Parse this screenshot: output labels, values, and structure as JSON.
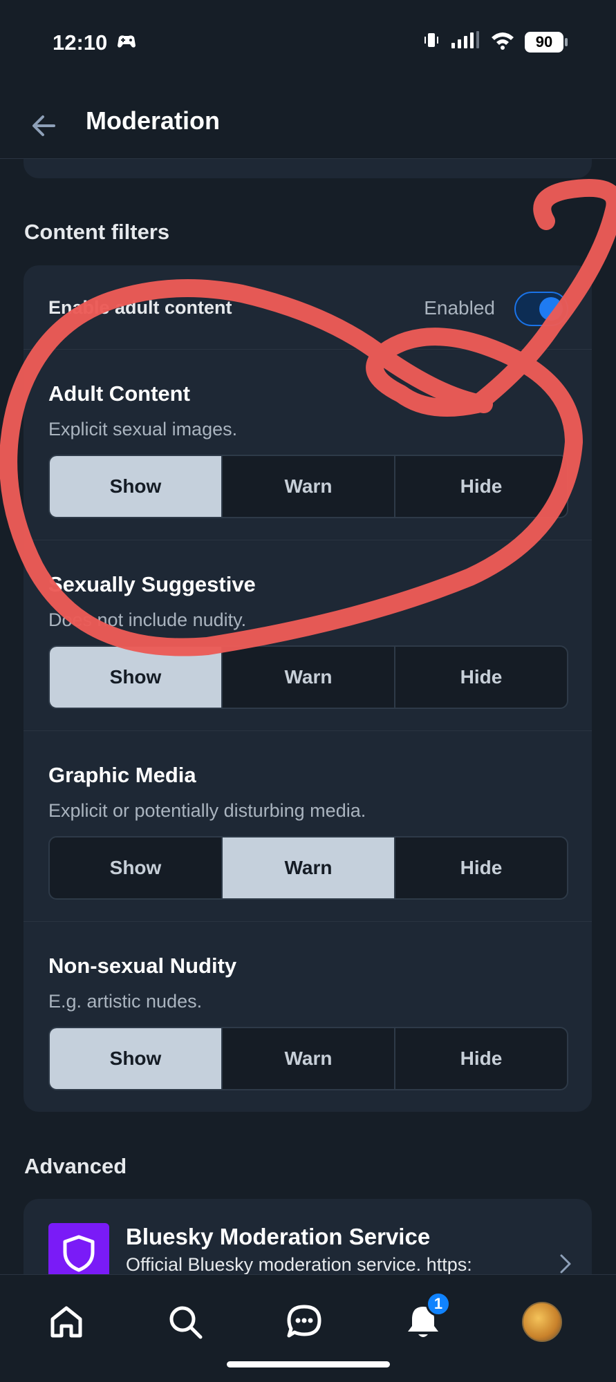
{
  "status_bar": {
    "time": "12:10",
    "battery": "90"
  },
  "header": {
    "title": "Moderation"
  },
  "content_filters": {
    "section_title": "Content filters",
    "adult_toggle": {
      "label": "Enable adult content",
      "state": "Enabled",
      "on": true
    },
    "filters": [
      {
        "name": "Adult Content",
        "description": "Explicit sexual images.",
        "options": [
          "Show",
          "Warn",
          "Hide"
        ],
        "selected": "Show"
      },
      {
        "name": "Sexually Suggestive",
        "description": "Does not include nudity.",
        "options": [
          "Show",
          "Warn",
          "Hide"
        ],
        "selected": "Show"
      },
      {
        "name": "Graphic Media",
        "description": "Explicit or potentially disturbing media.",
        "options": [
          "Show",
          "Warn",
          "Hide"
        ],
        "selected": "Warn"
      },
      {
        "name": "Non-sexual Nudity",
        "description": "E.g. artistic nudes.",
        "options": [
          "Show",
          "Warn",
          "Hide"
        ],
        "selected": "Show"
      }
    ]
  },
  "advanced": {
    "section_title": "Advanced",
    "service": {
      "name": "Bluesky Moderation Service",
      "description": "Official Bluesky moderation service. https:"
    }
  },
  "bottom_nav": {
    "items": [
      "home-icon",
      "search-icon",
      "chat-icon",
      "bell-icon",
      "avatar"
    ],
    "notifications_badge": "1"
  },
  "colors": {
    "accent": "#1f7bf2",
    "annotation": "#eb5b57",
    "selected_segment": "#c5d0dc"
  }
}
